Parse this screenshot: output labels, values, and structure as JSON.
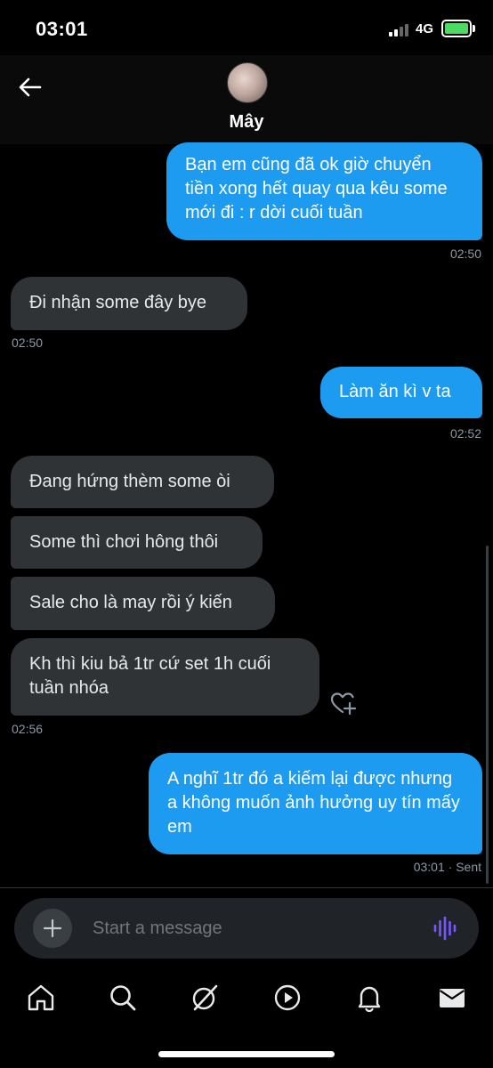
{
  "status_bar": {
    "time": "03:01",
    "network": "4G"
  },
  "header": {
    "contact_name": "Mây"
  },
  "messages": [
    {
      "side": "out",
      "text": "Bạn em cũng đã ok giờ chuyển tiền xong hết quay qua kêu some mới đi : r dời cuối tuần",
      "time": "02:50"
    },
    {
      "side": "in",
      "text": "Đi nhận some đây bye",
      "time": "02:50"
    },
    {
      "side": "out",
      "text": "Làm ăn kì v ta",
      "time": "02:52"
    },
    {
      "side": "in",
      "text": "Đang hứng thèm some òi"
    },
    {
      "side": "in",
      "text": "Some thì chơi hông thôi"
    },
    {
      "side": "in",
      "text": "Sale cho là may rồi ý kiến"
    },
    {
      "side": "in",
      "text": "Kh thì kiu bả 1tr cứ set 1h cuối tuần nhóa",
      "time": "02:56"
    },
    {
      "side": "out",
      "text": "A nghĩ 1tr đó a kiếm lại được nhưng a không muốn ảnh hưởng uy tín mấy em",
      "time": "03:01 · Sent"
    }
  ],
  "composer": {
    "placeholder": "Start a message"
  },
  "colors": {
    "accent": "#1d9bf0",
    "incoming_bubble": "#2f3336",
    "voice_icon": "#7856ff"
  },
  "nav": [
    {
      "icon": "home-icon"
    },
    {
      "icon": "search-icon"
    },
    {
      "icon": "grok-icon"
    },
    {
      "icon": "play-icon"
    },
    {
      "icon": "bell-icon"
    },
    {
      "icon": "mail-icon"
    }
  ]
}
